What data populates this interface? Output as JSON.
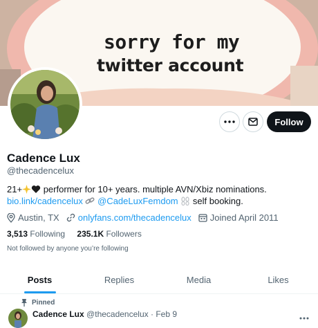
{
  "banner": {
    "line1": "sorry for my",
    "line2": "twitter account"
  },
  "actions": {
    "follow_label": "Follow"
  },
  "profile": {
    "name": "Cadence Lux",
    "handle": "@thecadencelux",
    "bio_line1_prefix": "21+",
    "bio_line1_text": "performer for 10+ years. multiple AVN/Xbiz nominations.",
    "bio_link": "bio.link/cadencelux",
    "bio_mention": "@CadeLuxFemdom",
    "bio_line2_suffix": "self booking.",
    "location": "Austin, TX",
    "website": "onlyfans.com/thecadencelux",
    "joined": "Joined April 2011",
    "following_count": "3,513",
    "following_label": "Following",
    "followers_count": "235.1K",
    "followers_label": "Followers",
    "not_followed": "Not followed by anyone you’re following"
  },
  "tabs": [
    "Posts",
    "Replies",
    "Media",
    "Likes"
  ],
  "pinned_post": {
    "pinned_label": "Pinned",
    "author": "Cadence Lux",
    "handle": "@thecadencelux",
    "separator": "·",
    "date": "Feb 9"
  },
  "colors": {
    "accent": "#1d9bf0",
    "text": "#0f1419",
    "muted": "#536471"
  }
}
